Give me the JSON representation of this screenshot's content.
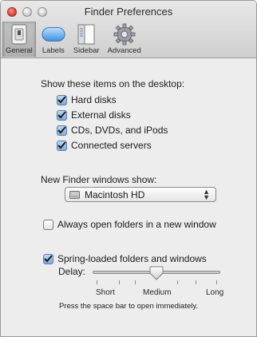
{
  "window": {
    "title": "Finder Preferences"
  },
  "toolbar": {
    "items": [
      {
        "label": "General",
        "icon": "general-switch-icon",
        "selected": true
      },
      {
        "label": "Labels",
        "icon": "labels-icon",
        "selected": false
      },
      {
        "label": "Sidebar",
        "icon": "sidebar-icon",
        "selected": false
      },
      {
        "label": "Advanced",
        "icon": "gear-icon",
        "selected": false
      }
    ]
  },
  "desktop": {
    "heading": "Show these items on the desktop:",
    "items": [
      {
        "label": "Hard disks",
        "checked": true
      },
      {
        "label": "External disks",
        "checked": true
      },
      {
        "label": "CDs, DVDs, and iPods",
        "checked": true
      },
      {
        "label": "Connected servers",
        "checked": true
      }
    ]
  },
  "new_window": {
    "heading": "New Finder windows show:",
    "selected": "Macintosh HD"
  },
  "always_open": {
    "label": "Always open folders in a new window",
    "checked": false
  },
  "spring_loaded": {
    "label": "Spring-loaded folders and windows",
    "checked": true,
    "delay_label": "Delay:",
    "delay_value": 0.5,
    "ticks": [
      "Short",
      "Medium",
      "Long"
    ],
    "hint": "Press the space bar to open immediately."
  },
  "colors": {
    "check_fill": "#7fa9dc",
    "window_bg": "#ededed",
    "close_red": "#e0443a"
  }
}
